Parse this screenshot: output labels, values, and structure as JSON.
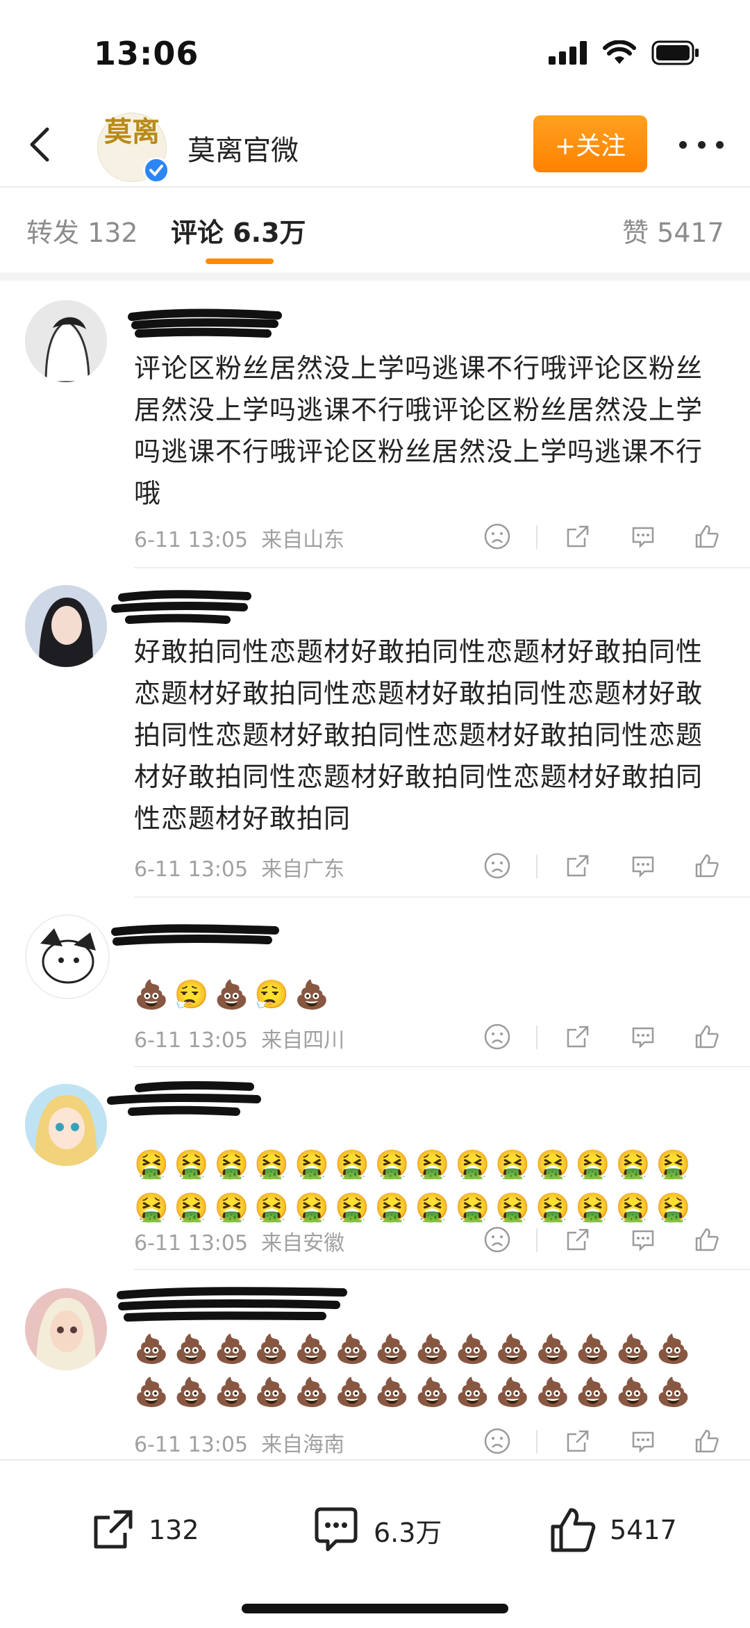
{
  "status_bar": {
    "time": "13:06"
  },
  "header": {
    "account_name": "莫离官微",
    "avatar_text": "莫离",
    "follow_label": "+关注"
  },
  "tabs": {
    "repost": "转发 132",
    "comments": "评论 6.3万",
    "likes": "赞 5417"
  },
  "comments": [
    {
      "text": "评论区粉丝居然没上学吗逃课不行哦评论区粉丝居然没上学吗逃课不行哦评论区粉丝居然没上学吗逃课不行哦评论区粉丝居然没上学吗逃课不行哦",
      "time": "6-11 13:05",
      "location": "来自山东"
    },
    {
      "text": "好敢拍同性恋题材好敢拍同性恋题材好敢拍同性恋题材好敢拍同性恋题材好敢拍同性恋题材好敢拍同性恋题材好敢拍同性恋题材好敢拍同性恋题材好敢拍同性恋题材好敢拍同性恋题材好敢拍同性恋题材好敢拍同",
      "time": "6-11 13:05",
      "location": "来自广东"
    },
    {
      "emoji_rows": [
        "💩😮‍💨💩😮‍💨💩"
      ],
      "time": "6-11 13:05",
      "location": "来自四川"
    },
    {
      "emoji_rows": [
        "🤮🤮🤮🤮🤮🤮🤮🤮🤮🤮🤮🤮🤮🤮",
        "🤮🤮🤮🤮🤮🤮🤮🤮🤮🤮🤮🤮🤮🤮"
      ],
      "time": "6-11 13:05",
      "location": "来自安徽"
    },
    {
      "emoji_rows": [
        "💩💩💩💩💩💩💩💩💩💩💩💩💩💩",
        "💩💩💩💩💩💩💩💩💩💩💩💩💩💩"
      ],
      "time": "6-11 13:05",
      "location": "来自海南"
    }
  ],
  "bottom_bar": {
    "repost_count": "132",
    "comment_count": "6.3万",
    "like_count": "5417"
  },
  "colors": {
    "accent": "#ff8a00",
    "follow_button": "#ff9a1a",
    "verified": "#2b86f3"
  }
}
